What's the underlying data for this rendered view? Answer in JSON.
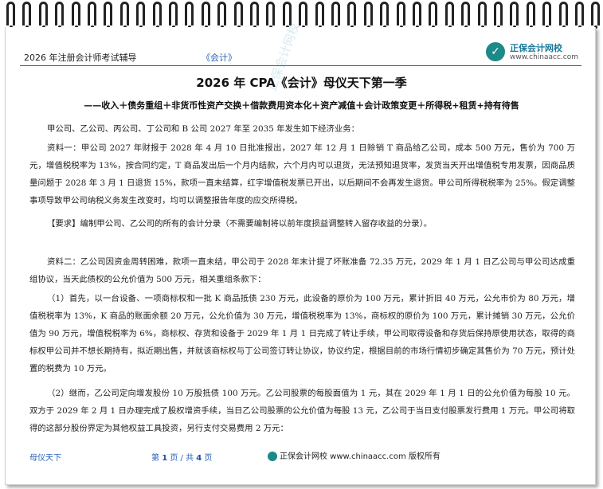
{
  "header": {
    "left": "2026 年注册会计师考试辅导",
    "middle": "《会计》",
    "logo_name": "正保会计网校",
    "logo_url": "www.chinaacc.com"
  },
  "title": "2026 年 CPA《会计》母仪天下第一季",
  "subtitle": "——收入＋债务重组＋非货币性资产交换＋借款费用资本化＋资产减值＋会计政策变更＋所得税+租赁+持有待售",
  "paragraphs": {
    "intro": "甲公司、乙公司、丙公司、丁公司和 B 公司 2027 年至 2035 年发生如下经济业务：",
    "material1": "资料一：甲公司 2027 年财报于 2028 年 4 月 10 日批准报出，2027 年 12 月 1 日赊销 T 商品给乙公司，成本 500 万元，售价为 700 万元，增值税税率为 13%，按合同约定，T 商品发出后一个月内结款，六个月内可以退货，无法预知退货率，发货当天开出增值税专用发票，因商品质量问题于 2028 年 3 月 1 日退货 15%，款项一直未结算，红字增值税发票已开出，以后期间不会再发生退货。甲公司所得税税率为 25%。假定调整事项导致甲公司纳税义务发生改变时，均可以调整报告年度的应交所得税。",
    "requirement": "【要求】编制甲公司、乙公司的所有的会计分录（不需要编制将以前年度损益调整转入留存收益的分录）。",
    "material2": "资料二：乙公司因资金周转困难，款项一直未结，甲公司于 2028 年末计提了坏账准备 72.35 万元，2029 年 1 月 1 日乙公司与甲公司达成重组协议，当天此债权的公允价值为 500 万元，相关重组条款下：",
    "item1": "（1）首先，以一台设备、一项商标权和一批 K 商品抵债 230 万元，此设备的原价为 100 万元，累计折旧 40 万元，公允市价为 80 万元，增值税税率为 13%，K 商品的账面余额 20 万元，公允价值为 30 万元，增值税税率为 13%，商标权的原价为 100 万元，累计摊销 30 万元，公允价值为 90 万元，增值税税率为 6%，商标权、存货和设备于 2029 年 1 月 1 日完成了转让手续，甲公司取得设备和存货后保持原使用状态，取得的商标权甲公司并不想长期持有，拟近期出售，并就该商标权与丁公司签订转让协议，协议约定，根据目前的市场行情初步确定其售价为 70 万元，预计处置的税费为 10 万元。",
    "item2": "（2）继而，乙公司定向增发股份 10 万股抵债 100 万元。乙公司股票的每股面值为 1 元，其在 2029 年 1 月 1 日的公允价值为每股 10 元。双方于 2029 年 2 月 1 日办理完成了股权增资手续，当日乙公司股票的公允价值为每股 13 元，乙公司于当日支付股票发行费用 1 万元。甲公司将取得的这部分股份界定为其他权益工具投资，另行支付交易费用 2 万元："
  },
  "footer": {
    "left": "母仪天下",
    "page_prefix": "第",
    "page_current": "1",
    "page_mid": "页 / 共",
    "page_total": "4",
    "page_suffix": "页",
    "brand": "正保会计网校 www.chinaacc.com 版权所有"
  },
  "watermark": "正保会计网校"
}
